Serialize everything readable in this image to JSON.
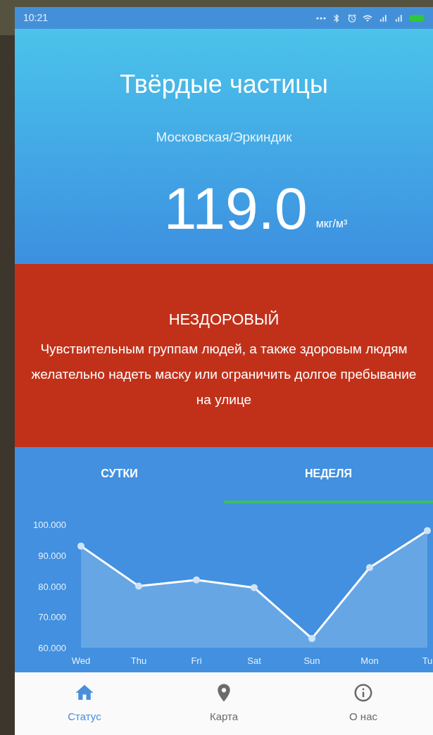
{
  "status_bar": {
    "time": "10:21"
  },
  "header": {
    "title": "Твёрдые частицы",
    "location": "Московская/Эркиндик",
    "value": "119.0",
    "unit": "мкг/м³"
  },
  "alert": {
    "level": "НЕЗДОРОВЫЙ",
    "color": "#c1311a",
    "message": "Чувствительным группам людей, а также здоровым людям желательно надеть маску или ограничить долгое пребывание на улице"
  },
  "tabs": [
    {
      "label": "СУТКИ",
      "selected": false
    },
    {
      "label": "НЕДЕЛЯ",
      "selected": true
    }
  ],
  "chart_data": {
    "type": "area",
    "categories": [
      "Wed",
      "Thu",
      "Fri",
      "Sat",
      "Sun",
      "Mon",
      "Tu"
    ],
    "series": [
      {
        "color": "#ffffff",
        "values": [
          93,
          80,
          82,
          79.5,
          63,
          86,
          98
        ]
      }
    ],
    "ylim": [
      60,
      100
    ],
    "yticks": [
      {
        "value": 60,
        "label": "60.000"
      },
      {
        "value": 70,
        "label": "70.000"
      },
      {
        "value": 80,
        "label": "80.000"
      },
      {
        "value": 90,
        "label": "90.000"
      },
      {
        "value": 100,
        "label": "100.000"
      }
    ]
  },
  "nav": [
    {
      "label": "Статус",
      "selected": true
    },
    {
      "label": "Карта",
      "selected": false
    },
    {
      "label": "О нас",
      "selected": false
    }
  ]
}
